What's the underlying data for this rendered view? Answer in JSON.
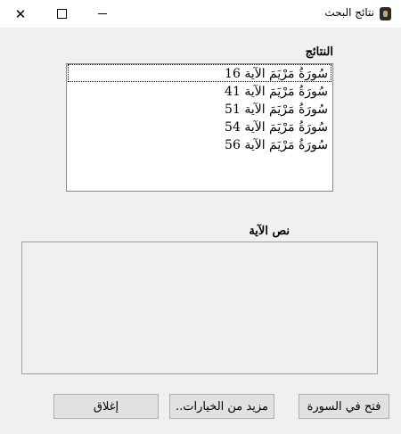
{
  "window": {
    "title": "نتائج البحث",
    "controls": {
      "close": "✕",
      "maximize": "",
      "minimize": ""
    }
  },
  "results": {
    "label": "النتائج",
    "items": [
      "سُورَةُ مَرْيَمَ الآية 16",
      "سُورَةُ مَرْيَمَ الآية 41",
      "سُورَةُ مَرْيَمَ الآية 51",
      "سُورَةُ مَرْيَمَ الآية 54",
      "سُورَةُ مَرْيَمَ الآية 56"
    ]
  },
  "verse_text": {
    "label": "نص الآية",
    "value": ""
  },
  "buttons": {
    "open": "فتح في السورة",
    "more": "مزيد من الخيارات..",
    "close": "إغلاق"
  }
}
